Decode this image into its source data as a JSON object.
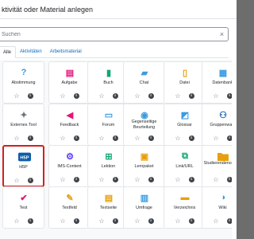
{
  "header": {
    "title": "ktivität oder Material anlegen"
  },
  "search": {
    "placeholder": "Suchen",
    "value": ""
  },
  "tabs": [
    {
      "label": "Alle",
      "active": true
    },
    {
      "label": "Aktivitäten",
      "active": false
    },
    {
      "label": "Arbeitsmaterial",
      "active": false
    }
  ],
  "tiles": [
    {
      "label": "Abstimmung",
      "icon": "question-icon",
      "glyph": "?",
      "color_class": "c-collab"
    },
    {
      "label": "Aufgabe",
      "icon": "document-upload-icon",
      "glyph": "▤",
      "color_class": "c-assess"
    },
    {
      "label": "Buch",
      "icon": "book-icon",
      "glyph": "▮",
      "color_class": "c-comm"
    },
    {
      "label": "Chat",
      "icon": "chat-bubbles-icon",
      "glyph": "▰",
      "color_class": "c-collab"
    },
    {
      "label": "Datei",
      "icon": "file-icon",
      "glyph": "▯",
      "color_class": "c-content"
    },
    {
      "label": "Datenbank",
      "icon": "database-icon",
      "glyph": "▦",
      "color_class": "c-collab"
    },
    {
      "label": "Externes Tool",
      "icon": "puzzle-icon",
      "glyph": "✦",
      "color_class": "c-other"
    },
    {
      "label": "Feedback",
      "icon": "megaphone-icon",
      "glyph": "◀",
      "color_class": "c-assess"
    },
    {
      "label": "Forum",
      "icon": "forum-icon",
      "glyph": "▭",
      "color_class": "c-collab"
    },
    {
      "label": "Gegenseitige Beurteilung",
      "icon": "workshop-icon",
      "glyph": "◉",
      "color_class": "c-collab"
    },
    {
      "label": "Glossar",
      "icon": "glossary-icon",
      "glyph": "◩",
      "color_class": "c-collab"
    },
    {
      "label": "Gruppenwahl",
      "icon": "group-icon",
      "glyph": "⚇",
      "color_class": "c-admin"
    },
    {
      "label": "H5P",
      "icon": "h5p-icon",
      "glyph": "H5P",
      "color_class": "c-admin",
      "selected": true
    },
    {
      "label": "IMS-Content",
      "icon": "ims-package-icon",
      "glyph": "⚙",
      "color_class": "c-interact"
    },
    {
      "label": "Lektion",
      "icon": "lesson-icon",
      "glyph": "⊞",
      "color_class": "c-comm"
    },
    {
      "label": "Lernpaket",
      "icon": "scorm-package-icon",
      "glyph": "▣",
      "color_class": "c-content"
    },
    {
      "label": "Link/URL",
      "icon": "link-icon",
      "glyph": "⧉",
      "color_class": "c-comm"
    },
    {
      "label": "Studierendenordner",
      "icon": "folder-icon",
      "glyph": "",
      "color_class": "c-content"
    },
    {
      "label": "Test",
      "icon": "quiz-icon",
      "glyph": "✔",
      "color_class": "c-assess"
    },
    {
      "label": "Textfeld",
      "icon": "label-icon",
      "glyph": "✎",
      "color_class": "c-content"
    },
    {
      "label": "Textseite",
      "icon": "page-icon",
      "glyph": "▤",
      "color_class": "c-content"
    },
    {
      "label": "Umfrage",
      "icon": "survey-icon",
      "glyph": "▥",
      "color_class": "c-collab"
    },
    {
      "label": "Verzeichnis",
      "icon": "directory-icon",
      "glyph": "▬",
      "color_class": "c-content"
    },
    {
      "label": "Wiki",
      "icon": "wiki-icon",
      "glyph": "◑",
      "color_class": "c-collab"
    }
  ]
}
